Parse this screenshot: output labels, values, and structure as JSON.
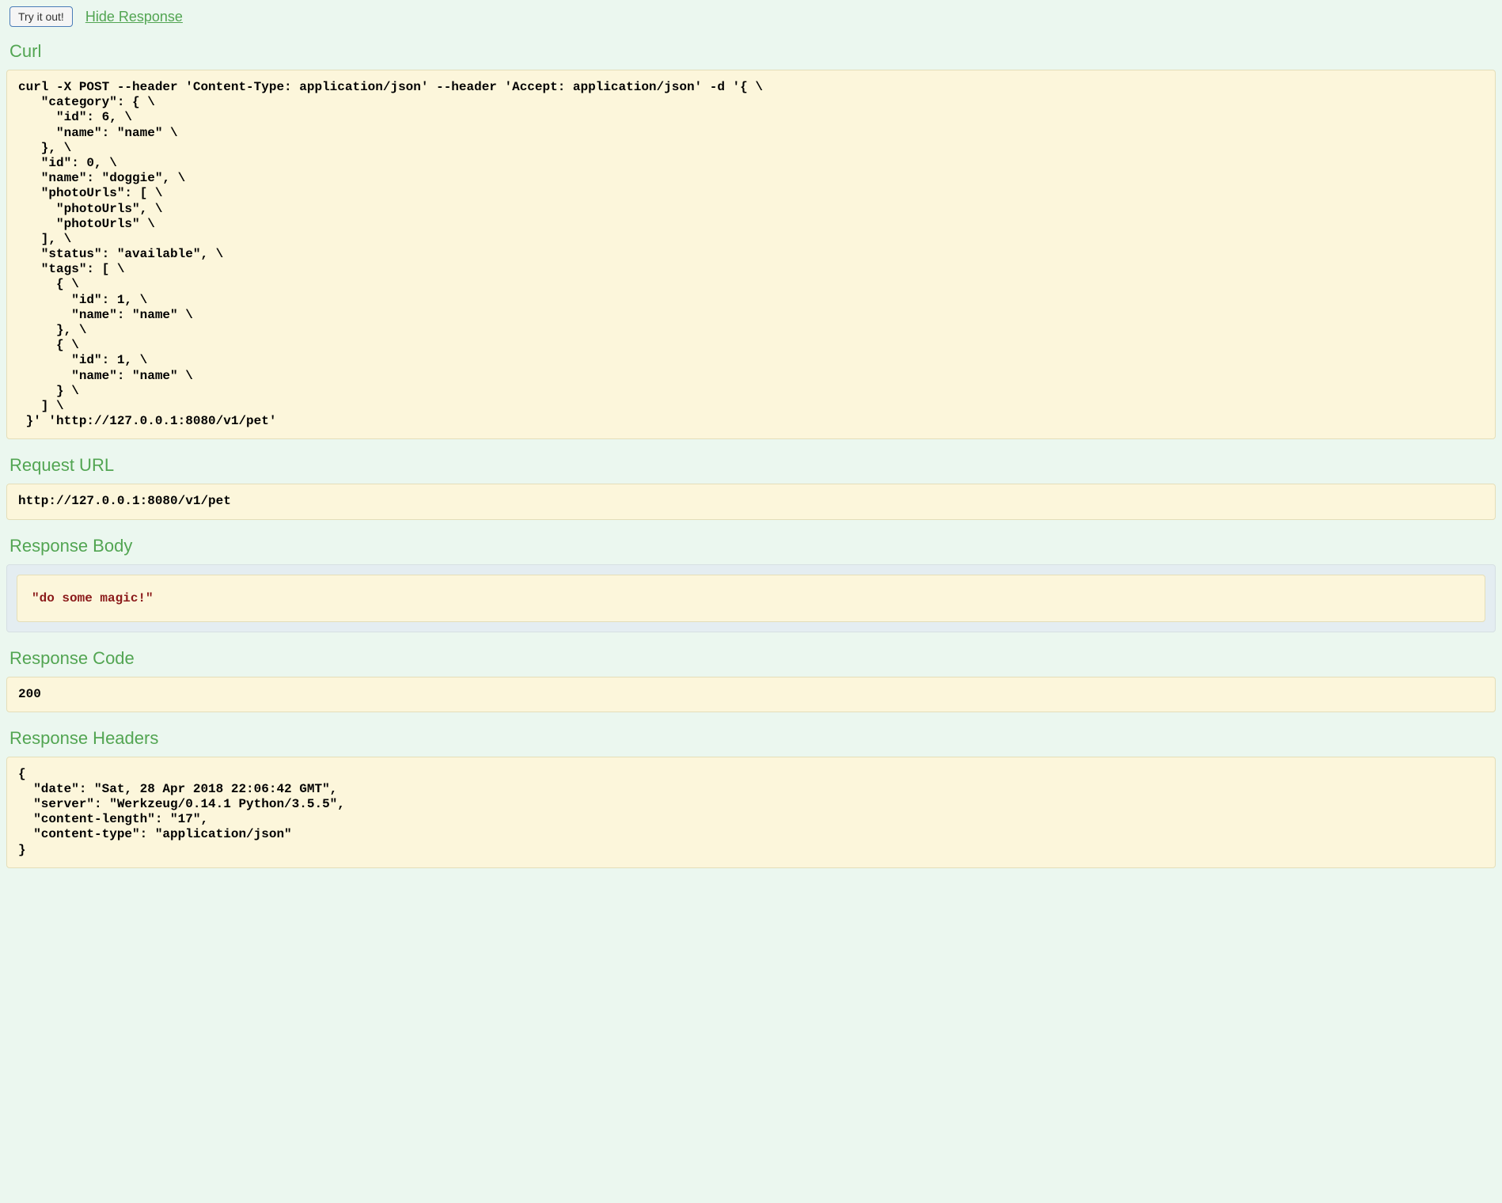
{
  "topBar": {
    "tryButton": "Try it out!",
    "hideLink": "Hide Response"
  },
  "sections": {
    "curl": {
      "heading": "Curl",
      "content": "curl -X POST --header 'Content-Type: application/json' --header 'Accept: application/json' -d '{ \\\n   \"category\": { \\\n     \"id\": 6, \\\n     \"name\": \"name\" \\\n   }, \\\n   \"id\": 0, \\\n   \"name\": \"doggie\", \\\n   \"photoUrls\": [ \\\n     \"photoUrls\", \\\n     \"photoUrls\" \\\n   ], \\\n   \"status\": \"available\", \\\n   \"tags\": [ \\\n     { \\\n       \"id\": 1, \\\n       \"name\": \"name\" \\\n     }, \\\n     { \\\n       \"id\": 1, \\\n       \"name\": \"name\" \\\n     } \\\n   ] \\\n }' 'http://127.0.0.1:8080/v1/pet'"
    },
    "requestUrl": {
      "heading": "Request URL",
      "content": "http://127.0.0.1:8080/v1/pet"
    },
    "responseBody": {
      "heading": "Response Body",
      "content": "\"do some magic!\""
    },
    "responseCode": {
      "heading": "Response Code",
      "content": "200"
    },
    "responseHeaders": {
      "heading": "Response Headers",
      "content": "{\n  \"date\": \"Sat, 28 Apr 2018 22:06:42 GMT\",\n  \"server\": \"Werkzeug/0.14.1 Python/3.5.5\",\n  \"content-length\": \"17\",\n  \"content-type\": \"application/json\"\n}"
    }
  }
}
